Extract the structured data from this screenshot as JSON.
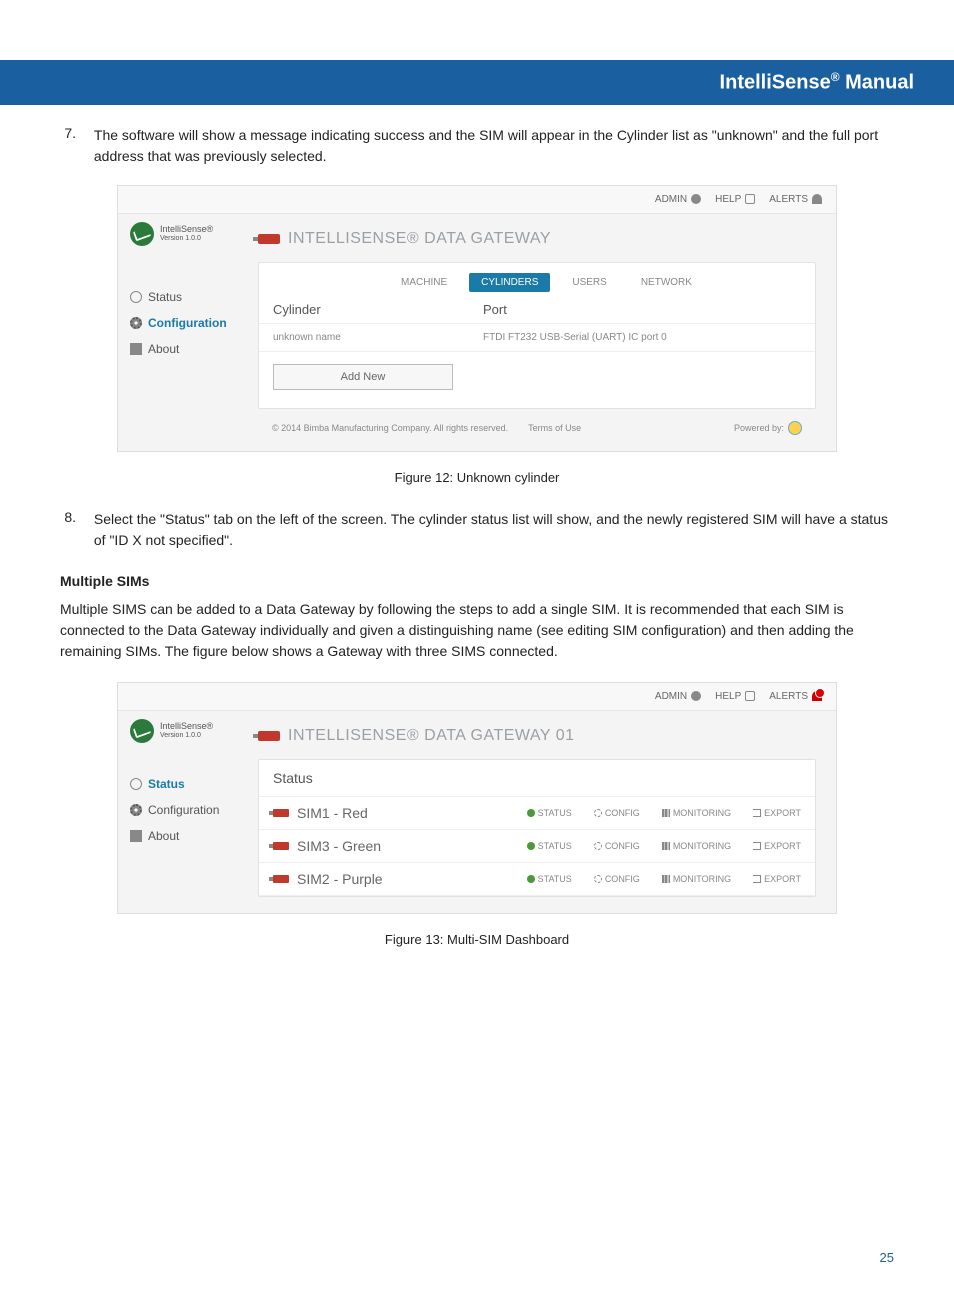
{
  "header": {
    "title_pre": "IntelliSense",
    "title_sup": "®",
    "title_post": " Manual"
  },
  "step7": {
    "num": "7.",
    "text": "The software will show a message indicating success and the SIM will appear in the Cylinder list as \"unknown\" and the full port address that was previously selected."
  },
  "step8": {
    "num": "8.",
    "text": "Select the \"Status\" tab on the left of the screen. The cylinder status list will show, and the newly registered SIM will have a status of \"ID X not specified\"."
  },
  "fig12": "Figure 12: Unknown cylinder",
  "fig13": "Figure 13: Multi-SIM Dashboard",
  "multi_heading": "Multiple SIMs",
  "multi_para": "Multiple SIMS can be added to a Data Gateway by following the steps to add a single SIM. It is recommended that each SIM is connected to the Data Gateway individually and given a distinguishing name (see editing SIM configuration) and then adding the remaining SIMs. The figure below shows a Gateway with three SIMS connected.",
  "page_num": "25",
  "shot1": {
    "topbar": {
      "admin": "ADMIN",
      "help": "HELP",
      "alerts": "ALERTS"
    },
    "logo": {
      "name": "IntelliSense®",
      "ver": "Version 1.0.0"
    },
    "side": {
      "status": "Status",
      "config": "Configuration",
      "about": "About"
    },
    "title": "INTELLISENSE® DATA GATEWAY",
    "tabs": {
      "machine": "MACHINE",
      "cylinders": "CYLINDERS",
      "users": "USERS",
      "network": "NETWORK"
    },
    "tbl": {
      "h1": "Cylinder",
      "h2": "Port",
      "r1c1": "unknown name",
      "r1c2": "FTDI FT232 USB-Serial (UART) IC port 0"
    },
    "add": "Add New",
    "foot": {
      "copy": "© 2014 Bimba Manufacturing Company. All rights reserved.",
      "terms": "Terms of Use",
      "pow": "Powered by:"
    }
  },
  "shot2": {
    "topbar": {
      "admin": "ADMIN",
      "help": "HELP",
      "alerts": "ALERTS"
    },
    "logo": {
      "name": "IntelliSense®",
      "ver": "Version 1.0.0"
    },
    "side": {
      "status": "Status",
      "config": "Configuration",
      "about": "About"
    },
    "title": "INTELLISENSE® DATA GATEWAY 01",
    "status_head": "Status",
    "rows": {
      "r1": "SIM1 - Red",
      "r2": "SIM3 - Green",
      "r3": "SIM2 - Purple"
    },
    "acts": {
      "status": "STATUS",
      "config": "CONFIG",
      "monitoring": "MONITORING",
      "export": "EXPORT"
    }
  }
}
